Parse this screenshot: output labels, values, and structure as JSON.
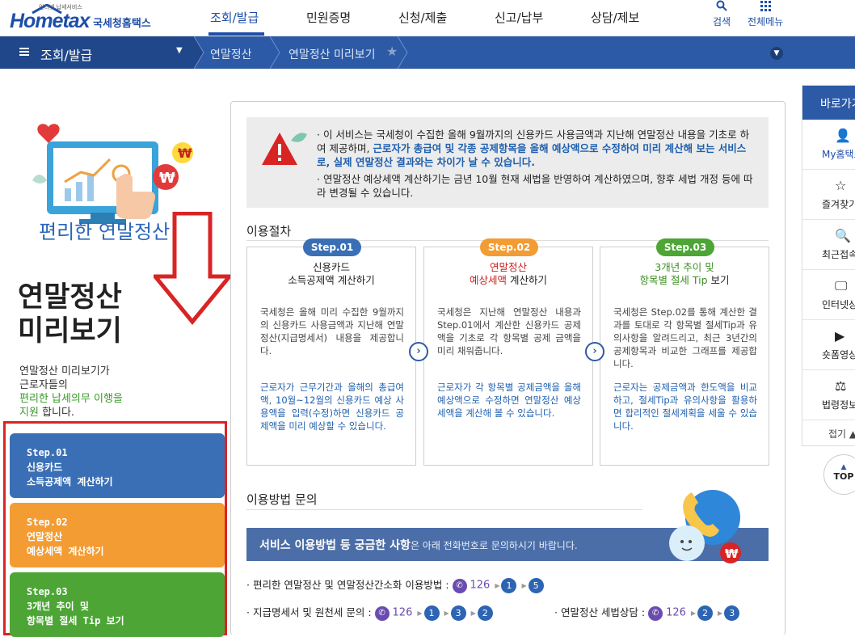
{
  "header": {
    "logo_small": "인터넷 납세서비스",
    "logo_main": "Hometax",
    "logo_sub": "국세청홈택스",
    "nav": [
      "조회/발급",
      "민원증명",
      "신청/제출",
      "신고/납부",
      "상담/제보"
    ],
    "search_label": "검색",
    "menu_label": "전체메뉴"
  },
  "subbar": {
    "title": "조회/발급",
    "crumbs": [
      "연말정산",
      "연말정산 미리보기"
    ]
  },
  "left": {
    "illus_title": "편리한 연말정산",
    "big_title_1": "연말정산",
    "big_title_2": "미리보기",
    "desc_1": "연말정산 미리보기가",
    "desc_2": "근로자들의",
    "desc_3": "편리한 납세의무 이행을",
    "desc_4a": "지원",
    "desc_4b": " 합니다.",
    "steps": [
      {
        "l1": "Step.01",
        "l2": "신용카드",
        "l3": "소득공제액 계산하기",
        "color": "#3a6fb6"
      },
      {
        "l1": "Step.02",
        "l2": "연말정산",
        "l3": "예상세액 계산하기",
        "color": "#f39c33"
      },
      {
        "l1": "Step.03",
        "l2": "3개년 추이 및",
        "l3": "항목별 절세 Tip 보기",
        "color": "#4da536"
      }
    ]
  },
  "notice": {
    "p1_a": "· 이 서비스는 국세청이 수집한 올해 9월까지의 신용카드 사용금액과 지난해 연말정산 내용을 기초로 하여 제공하며, ",
    "p1_b": "근로자가 총급여 및 각종 공제항목을 올해 예상액으로 수정하여 미리 계산해 보는 서비스로, 실제 연말정산 결과와는 차이가 날 수 있습니다.",
    "p2": "· 연말정산 예상세액 계산하기는 금년 10월 현재 세법을 반영하여 계산하였으며, 향후 세법 개정 등에 따라 변경될 수 있습니다."
  },
  "procedure": {
    "title": "이용절차",
    "cards": [
      {
        "pill": "Step.01",
        "pill_color": "#3a6fb6",
        "title_1": "신용카드",
        "title_2": "소득공제액 계산하기",
        "desc": "국세청은 올해 미리 수집한 9월까지의 신용카드 사용금액과 지난해 연말정산(지급명세서) 내용을 제공합니다.",
        "desc2": "근로자가 근무기간과 올해의 총급여액, 10월~12월의 신용카드 예상 사용액을 입력(수정)하면 신용카드 공제액을 미리 예상할 수 있습니다."
      },
      {
        "pill": "Step.02",
        "pill_color": "#f39c33",
        "title_1": "연말정산",
        "title_2a": "예상세액",
        "title_2b": " 계산하기",
        "desc": "국세청은 지난해 연말정산 내용과 Step.01에서 계산한 신용카드 공제액을 기초로 각 항목별 공제 금액을 미리 채워줍니다.",
        "desc2": "근로자가 각 항목별 공제금액을 올해예상액으로 수정하면 연말정산 예상세액을 계산해 볼 수 있습니다."
      },
      {
        "pill": "Step.03",
        "pill_color": "#4da536",
        "title_1": "3개년 추이 및",
        "title_2a": "항목별 절세 Tip",
        "title_2b": " 보기",
        "desc": "국세청은 Step.02를 통해 계산한 결과를 토대로 각 항목별 절세Tip과 유의사항을 알려드리고, 최근 3년간의 공제항목과 비교한 그래프를 제공합니다.",
        "desc2": "근로자는 공제금액과 한도액을 비교하고, 절세Tip과 유의사항을 활용하면 합리적인 절세계획을 세울 수 있습니다."
      }
    ]
  },
  "inquiry": {
    "title": "이용방법 문의",
    "banner_bold": "서비스 이용방법 등 궁금한 사항",
    "banner_rest": "은 아래 전화번호로 문의하시기 바랍니다.",
    "row1_label": "· 편리한 연말정산 및 연말정산간소화 이용방법 :",
    "row2_label": "· 지급명세서  및 원천세 문의 :",
    "row3_label": "· 연말정산 세법상담  :",
    "phone": "126",
    "row1_nums": [
      "1",
      "5"
    ],
    "row2_nums": [
      "1",
      "3",
      "2"
    ],
    "row3_nums": [
      "2",
      "3"
    ]
  },
  "rightbar": {
    "head": "바로가기",
    "items": [
      "My홈택스",
      "즐겨찾기",
      "최근접속",
      "인터넷상담",
      "숏폼영상",
      "법령정보"
    ],
    "fold": "접기 ▲",
    "top": "TOP"
  }
}
